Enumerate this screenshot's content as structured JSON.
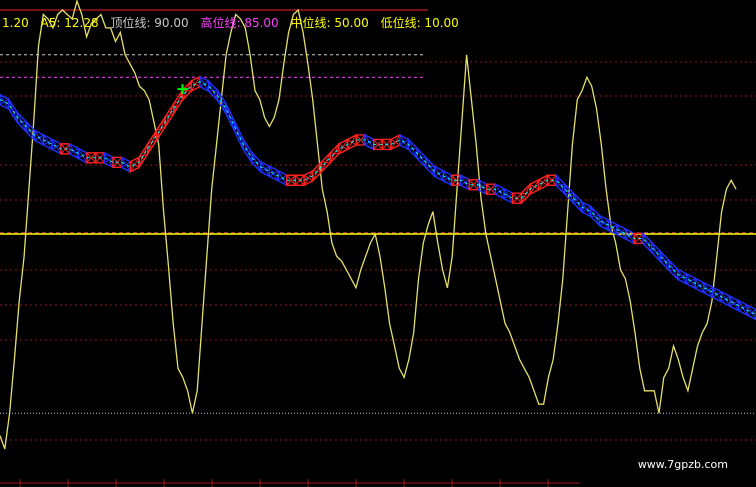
{
  "header": {
    "items": [
      {
        "text": "1.20",
        "color": "#ffff00"
      },
      {
        "text": "A5: 12.28",
        "color": "#ffff00"
      },
      {
        "text": "顶位线: 90.00",
        "color": "#c8c8c8"
      },
      {
        "text": "高位线: 85.00",
        "color": "#ff40ff"
      },
      {
        "text": "中位线: 50.00",
        "color": "#ffff00"
      },
      {
        "text": "低位线: 10.00",
        "color": "#ffff00"
      }
    ]
  },
  "watermark": "www.7gpzb.com",
  "colors": {
    "background": "#000000",
    "grid": "#8b1a1a",
    "oscillator": "#e6e06a",
    "band_up": "#ff2020",
    "band_down": "#2030ff",
    "band_mid": "#00ffff",
    "top_line": "#d0d0d0",
    "high_line": "#ff40ff",
    "mid_line": "#ffff00",
    "low_line": "#c8c8c8",
    "signal": "#00ff00"
  },
  "chart_data": {
    "type": "line",
    "ylim": [
      0,
      100
    ],
    "reference_lines": [
      {
        "name": "顶位线",
        "value": 90
      },
      {
        "name": "高位线",
        "value": 85
      },
      {
        "name": "中位线",
        "value": 50
      },
      {
        "name": "低位线",
        "value": 10
      }
    ],
    "series": [
      {
        "values": [
          5,
          2,
          10,
          22,
          35,
          45,
          60,
          75,
          92,
          99,
          98,
          96,
          99,
          100,
          99,
          98,
          102,
          99,
          94,
          97,
          98,
          99,
          96,
          96,
          93,
          95,
          90,
          88,
          86,
          83,
          82,
          80,
          75,
          70,
          55,
          43,
          30,
          20,
          18,
          15,
          10,
          15,
          30,
          45,
          60,
          70,
          80,
          90,
          95,
          99,
          98,
          96,
          90,
          82,
          80,
          76,
          74,
          76,
          80,
          88,
          95,
          99,
          100,
          95,
          88,
          80,
          70,
          60,
          55,
          48,
          45,
          44,
          42,
          40,
          38,
          42,
          45,
          48,
          50,
          45,
          38,
          30,
          25,
          20,
          18,
          22,
          28,
          40,
          48,
          52,
          55,
          48,
          42,
          38,
          45,
          60,
          75,
          90,
          80,
          70,
          58,
          50,
          45,
          40,
          35,
          30,
          28,
          25,
          22,
          20,
          18,
          15,
          12,
          12,
          18,
          22,
          30,
          40,
          55,
          70,
          80,
          82,
          85,
          83,
          78,
          70,
          60,
          52,
          48,
          42,
          40,
          35,
          28,
          20,
          15,
          15,
          15,
          10,
          18,
          20,
          25,
          22,
          18,
          15,
          20,
          25,
          28,
          30,
          35,
          45,
          55,
          60,
          62,
          60
        ]
      },
      {
        "values": [
          80,
          79,
          76,
          74,
          72,
          71,
          70,
          69,
          69,
          68,
          67,
          67,
          67,
          66,
          66,
          65,
          66,
          69,
          72,
          75,
          78,
          81,
          83,
          84,
          83,
          81,
          78,
          74,
          70,
          67,
          65,
          64,
          63,
          62,
          62,
          62,
          63,
          65,
          67,
          69,
          70,
          71,
          71,
          70,
          70,
          70,
          71,
          70,
          68,
          66,
          64,
          63,
          62,
          62,
          61,
          61,
          60,
          60,
          59,
          58,
          58,
          60,
          61,
          62,
          62,
          60,
          58,
          56,
          55,
          53,
          52,
          51,
          50,
          49,
          49,
          47,
          45,
          43,
          41,
          40,
          39,
          38,
          37,
          36,
          35,
          34,
          33,
          32
        ]
      }
    ]
  }
}
